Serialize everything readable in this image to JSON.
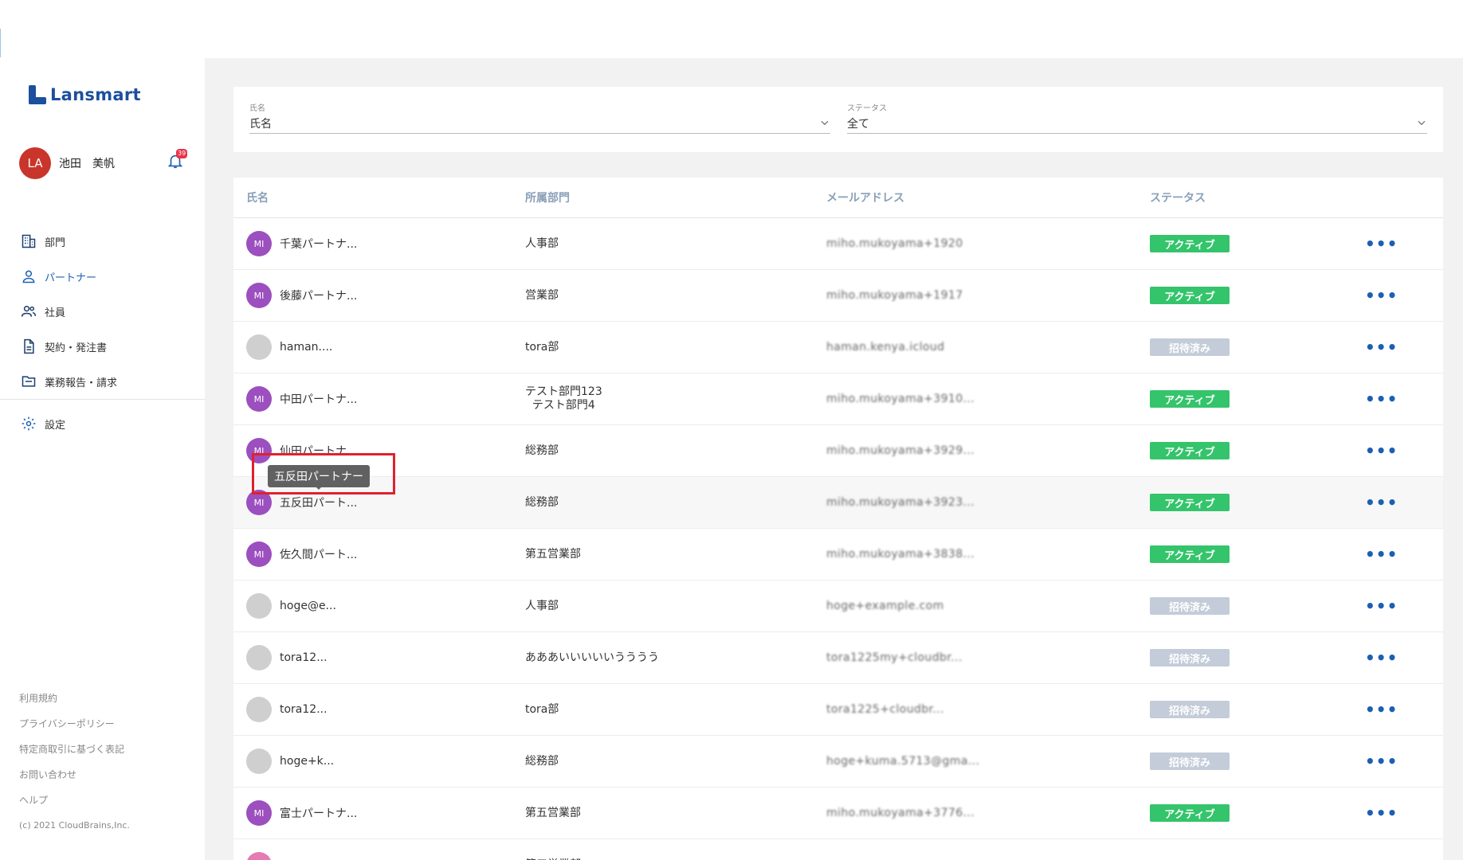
{
  "app": {
    "logo_text": "Lansmart"
  },
  "user": {
    "initials": "LA",
    "name": "池田　美帆",
    "notification_count": "39"
  },
  "nav": {
    "items": [
      {
        "label": "部門",
        "icon": "building-icon",
        "active": false
      },
      {
        "label": "パートナー",
        "icon": "person-icon",
        "active": true
      },
      {
        "label": "社員",
        "icon": "people-icon",
        "active": false
      },
      {
        "label": "契約・発注書",
        "icon": "document-icon",
        "active": false
      },
      {
        "label": "業務報告・請求",
        "icon": "folder-icon",
        "active": false
      }
    ],
    "settings_label": "設定"
  },
  "footer": {
    "links": [
      "利用規約",
      "プライバシーポリシー",
      "特定商取引に基づく表記",
      "お問い合わせ",
      "ヘルプ"
    ],
    "copyright": "(c) 2021 CloudBrains,Inc."
  },
  "filters": {
    "name": {
      "label": "氏名",
      "value": "氏名"
    },
    "status": {
      "label": "ステータス",
      "value": "全て"
    }
  },
  "table": {
    "headers": {
      "name": "氏名",
      "dept": "所属部門",
      "mail": "メールアドレス",
      "status": "ステータス"
    },
    "more_label": "•••",
    "rows": [
      {
        "initials": "MI",
        "avatar": "purple",
        "name": "千葉パートナ...",
        "dept": "人事部",
        "dept2": "",
        "mail": "miho.mukoyama+1920",
        "status": "アクティブ",
        "status_type": "active"
      },
      {
        "initials": "MI",
        "avatar": "purple",
        "name": "後藤パートナ...",
        "dept": "営業部",
        "dept2": "",
        "mail": "miho.mukoyama+1917",
        "status": "アクティブ",
        "status_type": "active"
      },
      {
        "initials": "",
        "avatar": "gray",
        "name": "haman....",
        "dept": "tora部",
        "dept2": "",
        "mail": "haman.kenya.icloud",
        "status": "招待済み",
        "status_type": "invited"
      },
      {
        "initials": "MI",
        "avatar": "purple",
        "name": "中田パートナ...",
        "dept": "テスト部門123",
        "dept2": "テスト部門4",
        "mail": "miho.mukoyama+3910...",
        "status": "アクティブ",
        "status_type": "active"
      },
      {
        "initials": "MI",
        "avatar": "purple",
        "name": "仙田パートナ...",
        "dept": "総務部",
        "dept2": "",
        "mail": "miho.mukoyama+3929...",
        "status": "アクティブ",
        "status_type": "active"
      },
      {
        "initials": "MI",
        "avatar": "purple",
        "name": "五反田パート...",
        "dept": "総務部",
        "dept2": "",
        "mail": "miho.mukoyama+3923...",
        "status": "アクティブ",
        "status_type": "active"
      },
      {
        "initials": "MI",
        "avatar": "purple",
        "name": "佐久間パート...",
        "dept": "第五営業部",
        "dept2": "",
        "mail": "miho.mukoyama+3838...",
        "status": "アクティブ",
        "status_type": "active"
      },
      {
        "initials": "",
        "avatar": "gray",
        "name": "hoge@e...",
        "dept": "人事部",
        "dept2": "",
        "mail": "hoge+example.com",
        "status": "招待済み",
        "status_type": "invited"
      },
      {
        "initials": "",
        "avatar": "gray",
        "name": "tora12...",
        "dept": "あああいいいいいうううう",
        "dept2": "",
        "mail": "tora1225my+cloudbr...",
        "status": "招待済み",
        "status_type": "invited"
      },
      {
        "initials": "",
        "avatar": "gray",
        "name": "tora12...",
        "dept": "tora部",
        "dept2": "",
        "mail": "tora1225+cloudbr...",
        "status": "招待済み",
        "status_type": "invited"
      },
      {
        "initials": "",
        "avatar": "gray",
        "name": "hoge+k...",
        "dept": "総務部",
        "dept2": "",
        "mail": "hoge+kuma.5713@gma...",
        "status": "招待済み",
        "status_type": "invited"
      },
      {
        "initials": "MI",
        "avatar": "purple",
        "name": "富士パートナ...",
        "dept": "第五営業部",
        "dept2": "",
        "mail": "miho.mukoyama+3776...",
        "status": "アクティブ",
        "status_type": "active"
      },
      {
        "initials": "",
        "avatar": "pink",
        "name": "",
        "dept": "第五営業部",
        "dept2": "",
        "mail": "",
        "status": "",
        "status_type": "active"
      }
    ]
  },
  "tooltip": {
    "text": "五反田パートナー"
  },
  "colors": {
    "brand": "#1c4f9c",
    "active": "#34c46b",
    "invited": "#c3ccd8",
    "highlight": "#e0212e"
  }
}
